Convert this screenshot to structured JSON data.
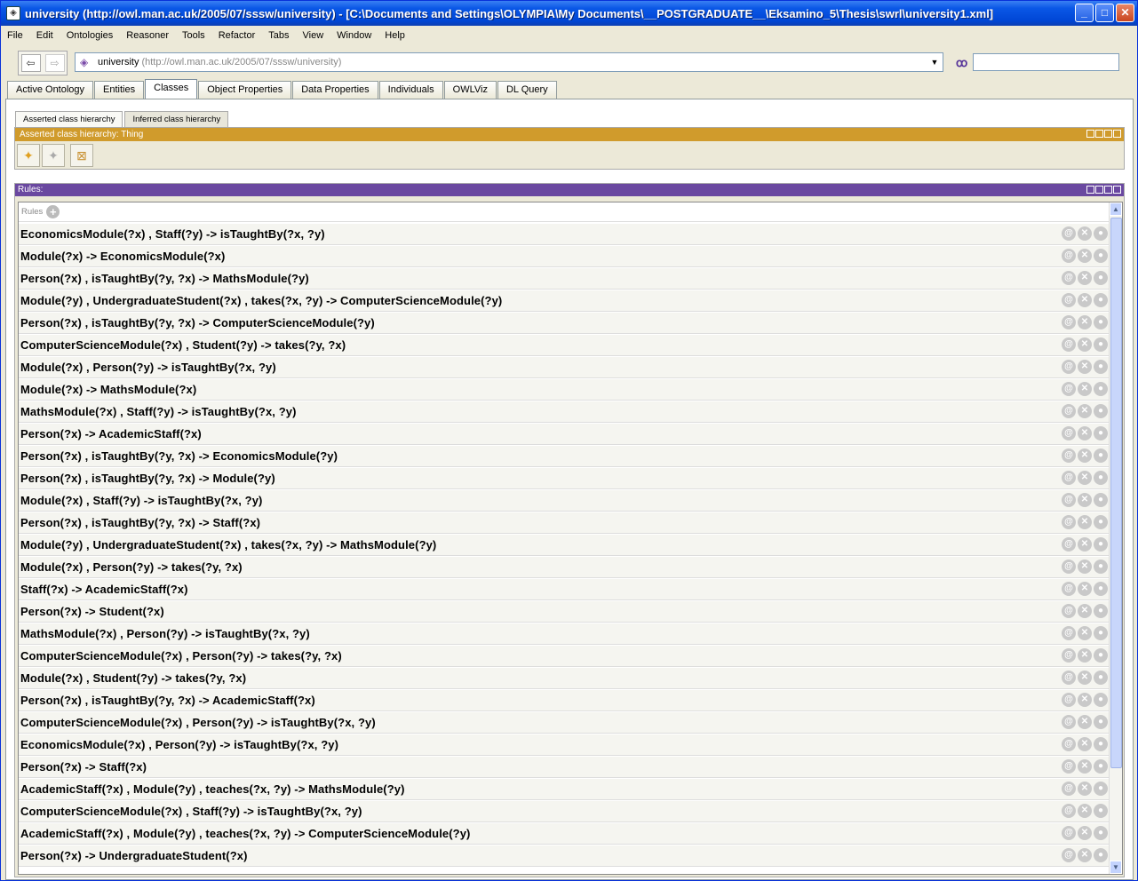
{
  "window": {
    "title": "university (http://owl.man.ac.uk/2005/07/sssw/university) - [C:\\Documents and Settings\\OLYMPIA\\My Documents\\__POSTGRADUATE__\\Eksamino_5\\Thesis\\swrl\\university1.xml]",
    "minimize": "_",
    "maximize": "□",
    "close": "✕"
  },
  "menu": [
    "File",
    "Edit",
    "Ontologies",
    "Reasoner",
    "Tools",
    "Refactor",
    "Tabs",
    "View",
    "Window",
    "Help"
  ],
  "nav": {
    "back": "⇦",
    "forward": "⇨"
  },
  "ontology": {
    "name": "university",
    "iri": "(http://owl.man.ac.uk/2005/07/sssw/university)"
  },
  "search": {
    "value": ""
  },
  "tabs": [
    "Active Ontology",
    "Entities",
    "Classes",
    "Object Properties",
    "Data Properties",
    "Individuals",
    "OWLViz",
    "DL Query"
  ],
  "active_tab": "Classes",
  "subtabs": [
    "Asserted class hierarchy",
    "Inferred class hierarchy"
  ],
  "hierarchy": {
    "header": "Asserted class hierarchy: Thing"
  },
  "rules": {
    "header": "Rules:",
    "label": "Rules",
    "items": [
      "EconomicsModule(?x) , Staff(?y) -> isTaughtBy(?x, ?y)",
      "Module(?x) -> EconomicsModule(?x)",
      "Person(?x) , isTaughtBy(?y, ?x) -> MathsModule(?y)",
      "Module(?y) , UndergraduateStudent(?x) , takes(?x, ?y) -> ComputerScienceModule(?y)",
      "Person(?x) , isTaughtBy(?y, ?x) -> ComputerScienceModule(?y)",
      "ComputerScienceModule(?x) , Student(?y) -> takes(?y, ?x)",
      "Module(?x) , Person(?y) -> isTaughtBy(?x, ?y)",
      "Module(?x) -> MathsModule(?x)",
      "MathsModule(?x) , Staff(?y) -> isTaughtBy(?x, ?y)",
      "Person(?x) -> AcademicStaff(?x)",
      "Person(?x) , isTaughtBy(?y, ?x) -> EconomicsModule(?y)",
      "Person(?x) , isTaughtBy(?y, ?x) -> Module(?y)",
      "Module(?x) , Staff(?y) -> isTaughtBy(?x, ?y)",
      "Person(?x) , isTaughtBy(?y, ?x) -> Staff(?x)",
      "Module(?y) , UndergraduateStudent(?x) , takes(?x, ?y) -> MathsModule(?y)",
      "Module(?x) , Person(?y) -> takes(?y, ?x)",
      "Staff(?x) -> AcademicStaff(?x)",
      "Person(?x) -> Student(?x)",
      "MathsModule(?x) , Person(?y) -> isTaughtBy(?x, ?y)",
      "ComputerScienceModule(?x) , Person(?y) -> takes(?y, ?x)",
      "Module(?x) , Student(?y) -> takes(?y, ?x)",
      "Person(?x) , isTaughtBy(?y, ?x) -> AcademicStaff(?x)",
      "ComputerScienceModule(?x) , Person(?y) -> isTaughtBy(?x, ?y)",
      "EconomicsModule(?x) , Person(?y) -> isTaughtBy(?x, ?y)",
      "Person(?x) -> Staff(?x)",
      "AcademicStaff(?x) , Module(?y) , teaches(?x, ?y) -> MathsModule(?y)",
      "ComputerScienceModule(?x) , Staff(?y) -> isTaughtBy(?x, ?y)",
      "AcademicStaff(?x) , Module(?y) , teaches(?x, ?y) -> ComputerScienceModule(?y)",
      "Person(?x) -> UndergraduateStudent(?x)"
    ]
  }
}
